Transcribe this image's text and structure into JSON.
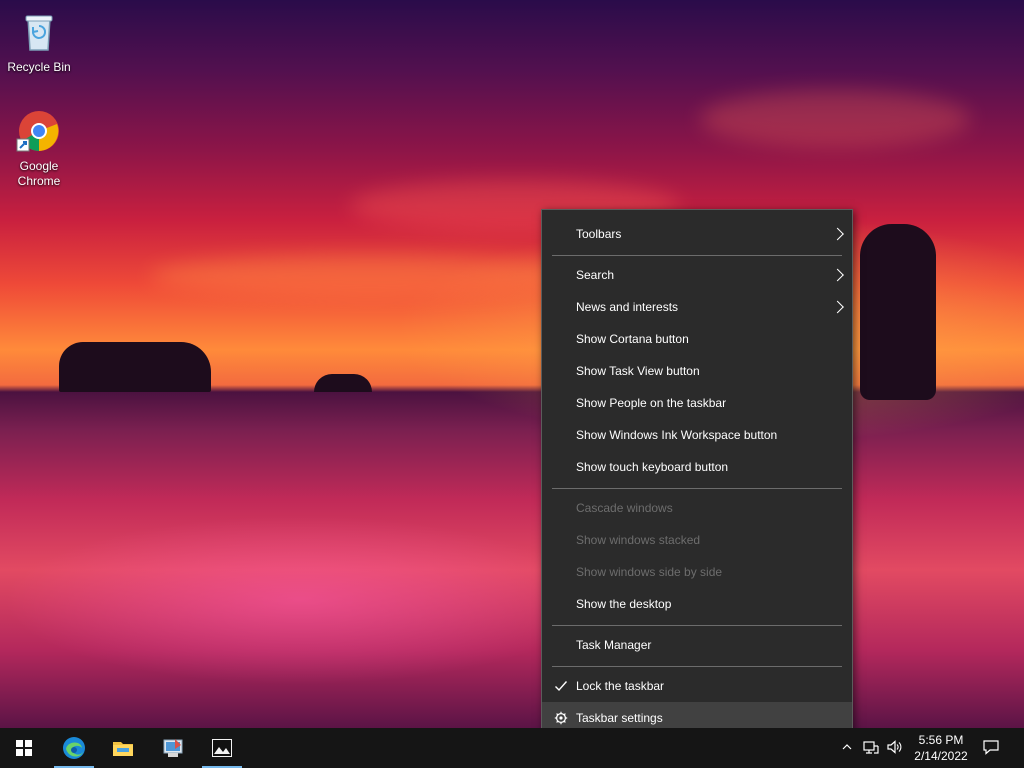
{
  "desktop": {
    "icons": [
      {
        "label": "Recycle Bin",
        "icon": "recycle-bin-icon"
      },
      {
        "label": "Google\nChrome",
        "icon": "chrome-icon"
      }
    ]
  },
  "context_menu": {
    "items": [
      {
        "label": "Toolbars",
        "submenu": true,
        "disabled": false
      },
      {
        "label": "Search",
        "submenu": true,
        "disabled": false
      },
      {
        "label": "News and interests",
        "submenu": true,
        "disabled": false
      },
      {
        "label": "Show Cortana button",
        "submenu": false,
        "disabled": false
      },
      {
        "label": "Show Task View button",
        "submenu": false,
        "disabled": false
      },
      {
        "label": "Show People on the taskbar",
        "submenu": false,
        "disabled": false
      },
      {
        "label": "Show Windows Ink Workspace button",
        "submenu": false,
        "disabled": false
      },
      {
        "label": "Show touch keyboard button",
        "submenu": false,
        "disabled": false
      },
      {
        "label": "Cascade windows",
        "submenu": false,
        "disabled": true
      },
      {
        "label": "Show windows stacked",
        "submenu": false,
        "disabled": true
      },
      {
        "label": "Show windows side by side",
        "submenu": false,
        "disabled": true
      },
      {
        "label": "Show the desktop",
        "submenu": false,
        "disabled": false
      },
      {
        "label": "Task Manager",
        "submenu": false,
        "disabled": false
      },
      {
        "label": "Lock the taskbar",
        "submenu": false,
        "disabled": false,
        "checked": true
      },
      {
        "label": "Taskbar settings",
        "submenu": false,
        "disabled": false,
        "icon": "gear-icon",
        "highlighted": true
      }
    ]
  },
  "taskbar": {
    "start_icon": "windows-logo-icon",
    "pinned": [
      {
        "icon": "edge-icon",
        "running": true
      },
      {
        "icon": "file-explorer-icon",
        "running": false
      },
      {
        "icon": "control-panel-icon",
        "running": false
      },
      {
        "icon": "photos-icon",
        "running": true
      }
    ],
    "tray": {
      "overflow_icon": "chevron-up-icon",
      "network_icon": "network-icon",
      "volume_icon": "volume-icon",
      "notification_icon": "action-center-icon"
    },
    "clock": {
      "time": "5:56 PM",
      "date": "2/14/2022"
    }
  },
  "colors": {
    "menu_bg": "#2b2b2b",
    "menu_hover": "#414141",
    "taskbar_bg": "#151515",
    "accent": "#76b9ed"
  }
}
